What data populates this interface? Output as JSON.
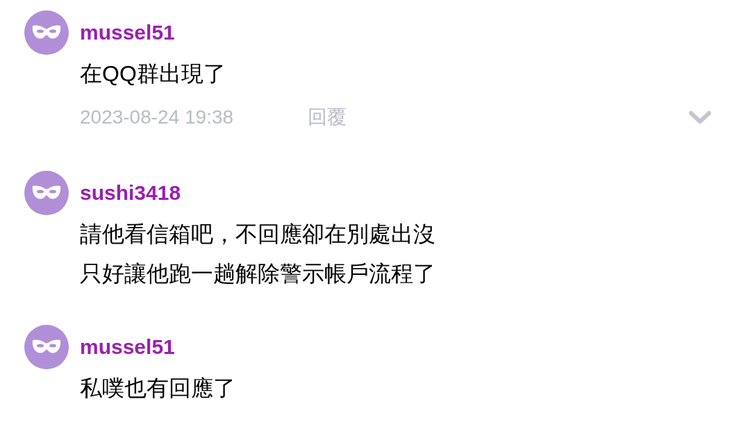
{
  "comments": [
    {
      "username": "mussel51",
      "lines": [
        "在QQ群出現了"
      ],
      "time": "2023-08-24 19:38",
      "reply": "回覆"
    },
    {
      "username": "sushi3418",
      "lines": [
        "請他看信箱吧，不回應卻在別處出沒",
        "只好讓他跑一趟解除警示帳戶流程了"
      ]
    },
    {
      "username": "mussel51",
      "lines": [
        "私噗也有回應了"
      ]
    }
  ]
}
